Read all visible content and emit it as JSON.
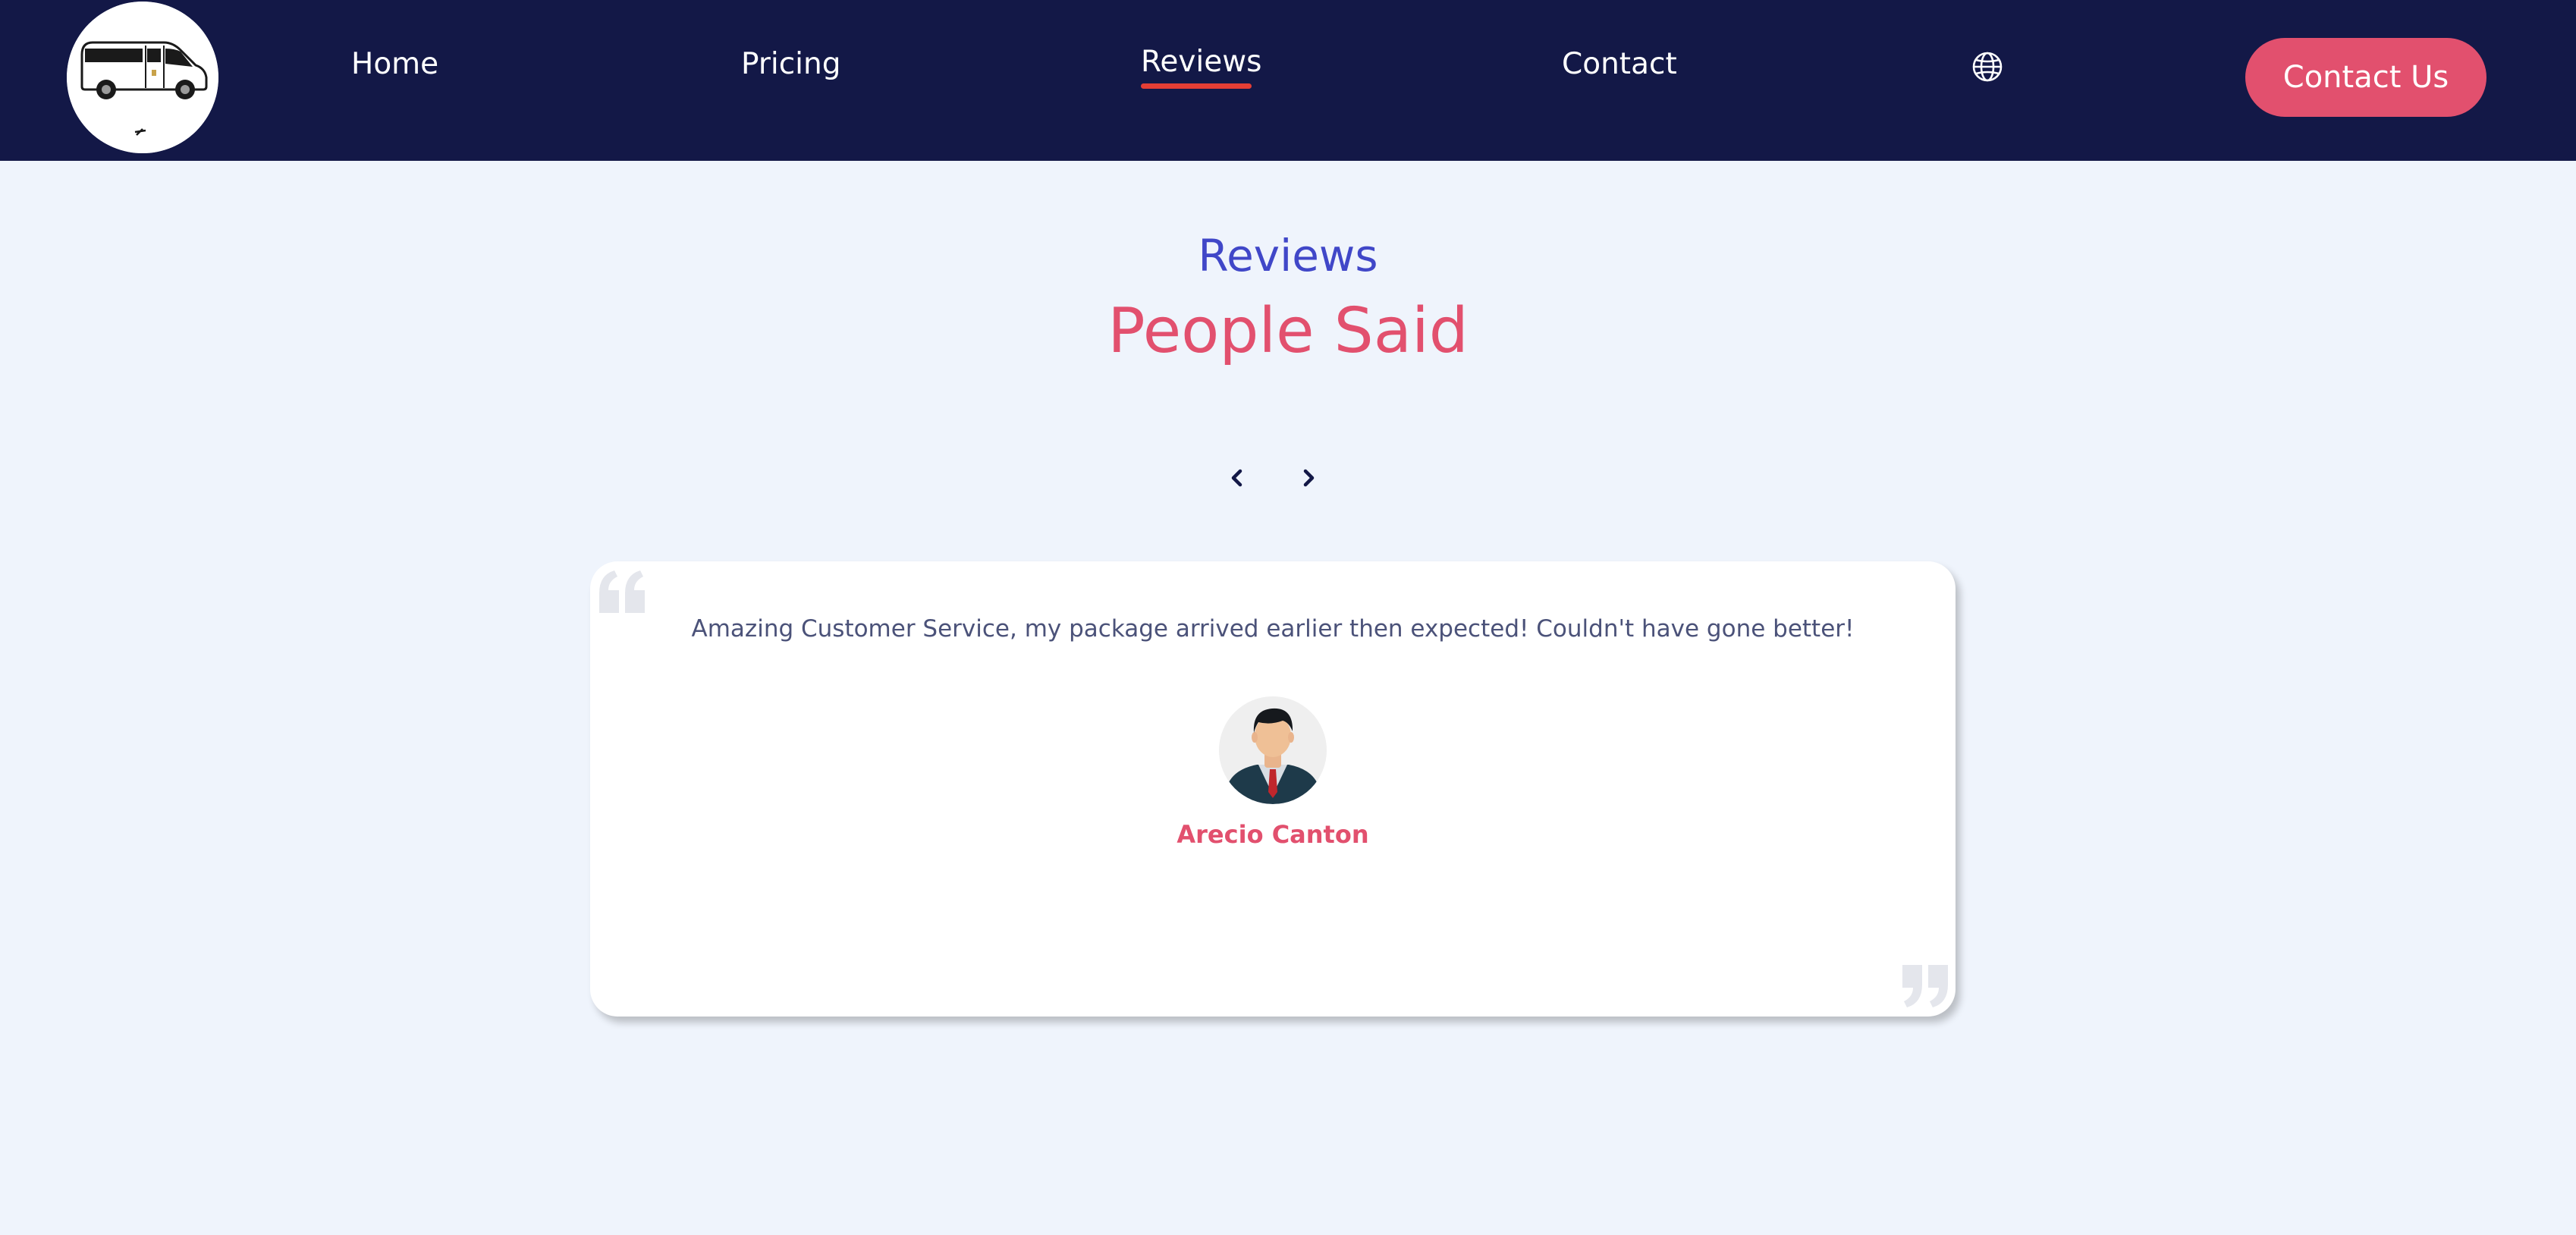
{
  "header": {
    "logo_icon": "van-logo-icon",
    "nav": {
      "home": "Home",
      "pricing": "Pricing",
      "reviews": "Reviews",
      "contact": "Contact"
    },
    "active_nav": "Reviews",
    "language_icon": "globe-icon",
    "cta_label": "Contact Us"
  },
  "section": {
    "subtitle": "Reviews",
    "title": "People Said"
  },
  "carousel": {
    "prev_icon": "chevron-left-icon",
    "next_icon": "chevron-right-icon"
  },
  "review": {
    "text": "Amazing Customer Service, my package arrived earlier then expected! Couldn't have gone better!",
    "name": "Arecio Canton",
    "avatar_icon": "male-avatar-icon",
    "open_quote_icon": "quote-open-icon",
    "close_quote_icon": "quote-close-icon"
  },
  "colors": {
    "nav_background": "#131847",
    "page_background": "#eff4fc",
    "accent_pink": "#e2506e",
    "accent_blue": "#4047c8",
    "active_underline": "#e43e35"
  }
}
